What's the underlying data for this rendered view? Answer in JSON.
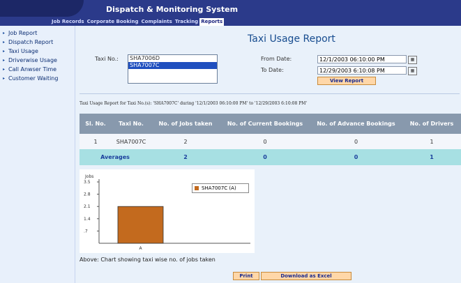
{
  "app_title": "Dispatch & Monitoring System",
  "tabs": [
    "Job Records",
    "Corporate Booking",
    "Complaints",
    "Tracking",
    "Reports"
  ],
  "sidebar": [
    "Job Report",
    "Dispatch Report",
    "Taxi Usage",
    "Driverwise Usage",
    "Call Anwser Time",
    "Customer Waiting"
  ],
  "report": {
    "title": "Taxi Usage Report",
    "taxi_label": "Taxi No.:",
    "taxi_options": [
      "SHA7006D",
      "SHA7007C"
    ],
    "from_label": "From Date:",
    "from_value": "12/1/2003 06:10:00 PM",
    "to_label": "To Date:",
    "to_value": "12/29/2003 6:10:08 PM",
    "view_button": "View Report",
    "caption": "Taxi Usage Report for Taxi No.(s): 'SHA7007C' during '12/1/2003 06:10:00 PM' to '12/29/2003 6:10:08 PM'"
  },
  "table": {
    "headers": [
      "Sl. No.",
      "Taxi No.",
      "No. of Jobs taken",
      "No. of Current Bookings",
      "No. of Advance Bookings",
      "No. of Drivers"
    ],
    "rows": [
      [
        "1",
        "SHA7007C",
        "2",
        "0",
        "0",
        "1"
      ]
    ],
    "averages": [
      "Averages",
      "2",
      "0",
      "0",
      "1"
    ]
  },
  "chart_data": {
    "type": "bar",
    "categories": [
      "A"
    ],
    "series": [
      {
        "name": "SHA7007C (A)",
        "values": [
          2.1
        ],
        "color": "#c36a1e"
      }
    ],
    "ylabel": "Jobs",
    "yticks": [
      ".7",
      "1.4",
      "2.1",
      "2.8",
      "3.5"
    ],
    "ylim": [
      0,
      3.5
    ]
  },
  "chart_note": "Above: Chart showing taxi wise no. of jobs taken",
  "footer": {
    "print": "Print",
    "excel": "Download as Excel"
  }
}
